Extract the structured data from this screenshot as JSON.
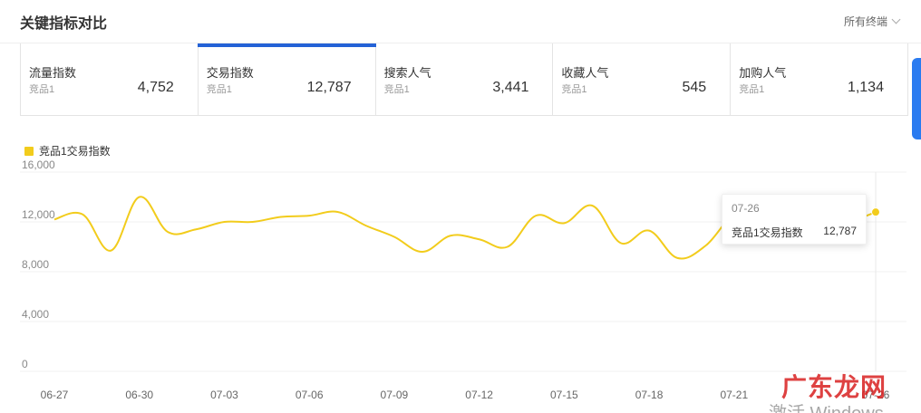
{
  "header": {
    "title": "关键指标对比",
    "filter_label": "所有终端"
  },
  "cards": [
    {
      "label": "流量指数",
      "sub": "竞品1",
      "value": "4,752",
      "active": false
    },
    {
      "label": "交易指数",
      "sub": "竞品1",
      "value": "12,787",
      "active": true
    },
    {
      "label": "搜索人气",
      "sub": "竞品1",
      "value": "3,441",
      "active": false
    },
    {
      "label": "收藏人气",
      "sub": "竞品1",
      "value": "545",
      "active": false
    },
    {
      "label": "加购人气",
      "sub": "竞品1",
      "value": "1,134",
      "active": false
    }
  ],
  "legend": {
    "label": "竞品1交易指数",
    "color": "#f2cc1c"
  },
  "tooltip": {
    "date": "07-26",
    "label": "竞品1交易指数",
    "value": "12,787"
  },
  "watermark": {
    "text": "广东龙网",
    "os_text": "激活 Windows"
  },
  "chart_data": {
    "type": "line",
    "ylim": [
      0,
      16000
    ],
    "yticks": [
      "0",
      "4,000",
      "8,000",
      "12,000",
      "16,000"
    ],
    "xticks": [
      "06-27",
      "06-30",
      "07-03",
      "07-06",
      "07-09",
      "07-12",
      "07-15",
      "07-18",
      "07-21",
      "07-26"
    ],
    "series": [
      {
        "name": "竞品1交易指数",
        "color": "#f2cc1c",
        "x": [
          "06-27",
          "06-28",
          "06-29",
          "06-30",
          "07-01",
          "07-02",
          "07-03",
          "07-04",
          "07-05",
          "07-06",
          "07-07",
          "07-08",
          "07-09",
          "07-10",
          "07-11",
          "07-12",
          "07-13",
          "07-14",
          "07-15",
          "07-16",
          "07-17",
          "07-18",
          "07-19",
          "07-20",
          "07-21",
          "07-22",
          "07-23",
          "07-24",
          "07-25",
          "07-26"
        ],
        "values": [
          12200,
          12600,
          9700,
          14000,
          11200,
          11400,
          12000,
          12000,
          12400,
          12500,
          12800,
          11700,
          10800,
          9600,
          10900,
          10600,
          10000,
          12500,
          11900,
          13300,
          10300,
          11300,
          9100,
          10100,
          12600,
          12900,
          11300,
          10300,
          11800,
          12787
        ]
      }
    ]
  }
}
